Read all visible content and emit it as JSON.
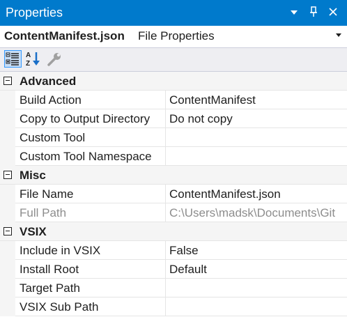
{
  "window": {
    "title": "Properties",
    "accent": "#007acc"
  },
  "object_selector": {
    "object_name": "ContentManifest.json",
    "object_type": "File Properties"
  },
  "toolbar": {
    "buttons": [
      {
        "icon": "categorized-icon",
        "active": true
      },
      {
        "icon": "alphabetical-icon",
        "active": false
      },
      {
        "icon": "property-pages-icon",
        "active": false
      }
    ]
  },
  "grid": {
    "categories": [
      {
        "name": "Advanced",
        "properties": [
          {
            "name": "Build Action",
            "value": "ContentManifest"
          },
          {
            "name": "Copy to Output Directory",
            "value": "Do not copy"
          },
          {
            "name": "Custom Tool",
            "value": ""
          },
          {
            "name": "Custom Tool Namespace",
            "value": ""
          }
        ]
      },
      {
        "name": "Misc",
        "properties": [
          {
            "name": "File Name",
            "value": "ContentManifest.json"
          },
          {
            "name": "Full Path",
            "value": "C:\\Users\\madsk\\Documents\\Git",
            "readonly": true
          }
        ]
      },
      {
        "name": "VSIX",
        "properties": [
          {
            "name": "Include in VSIX",
            "value": "False"
          },
          {
            "name": "Install Root",
            "value": "Default"
          },
          {
            "name": "Target Path",
            "value": ""
          },
          {
            "name": "VSIX Sub Path",
            "value": ""
          }
        ]
      }
    ]
  }
}
